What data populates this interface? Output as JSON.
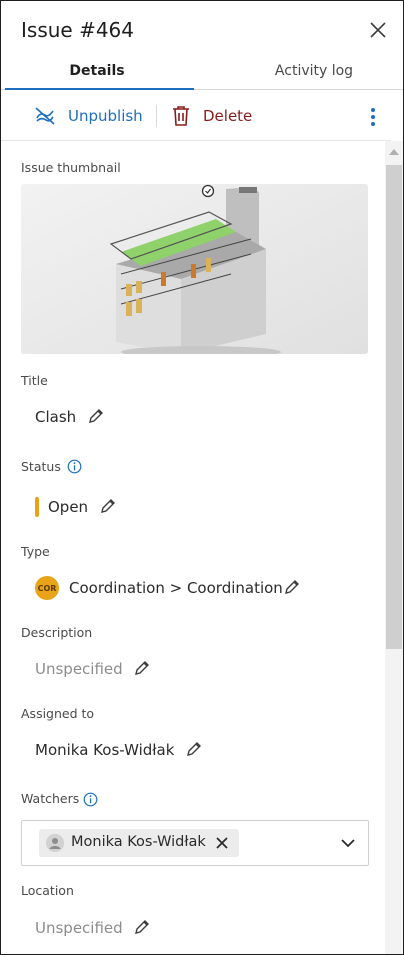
{
  "header": {
    "title": "Issue #464"
  },
  "tabs": [
    {
      "label": "Details"
    },
    {
      "label": "Activity log"
    }
  ],
  "toolbar": {
    "unpublish_label": "Unpublish",
    "delete_label": "Delete"
  },
  "colors": {
    "accent": "#1e6fbf",
    "delete": "#8a1b1b",
    "status_open": "#e8a317",
    "type_badge": "#e8a317"
  },
  "fields": {
    "thumbnail_label": "Issue thumbnail",
    "title_label": "Title",
    "title_value": "Clash",
    "status_label": "Status",
    "status_value": "Open",
    "type_label": "Type",
    "type_badge": "COR",
    "type_value": "Coordination > Coordination",
    "description_label": "Description",
    "description_value": "Unspecified",
    "assigned_label": "Assigned to",
    "assigned_value": "Monika Kos-Widłak",
    "watchers_label": "Watchers",
    "watchers": [
      {
        "name": "Monika Kos-Widłak"
      }
    ],
    "location_label": "Location",
    "location_value": "Unspecified"
  },
  "icons": {
    "close": "close-icon",
    "unpublish": "unpublish-icon",
    "delete": "trash-icon",
    "more": "more-vertical-icon",
    "edit": "pencil-icon",
    "info": "info-icon",
    "avatar": "user-avatar-icon",
    "remove": "remove-x-icon",
    "dropdown": "chevron-down-icon"
  }
}
